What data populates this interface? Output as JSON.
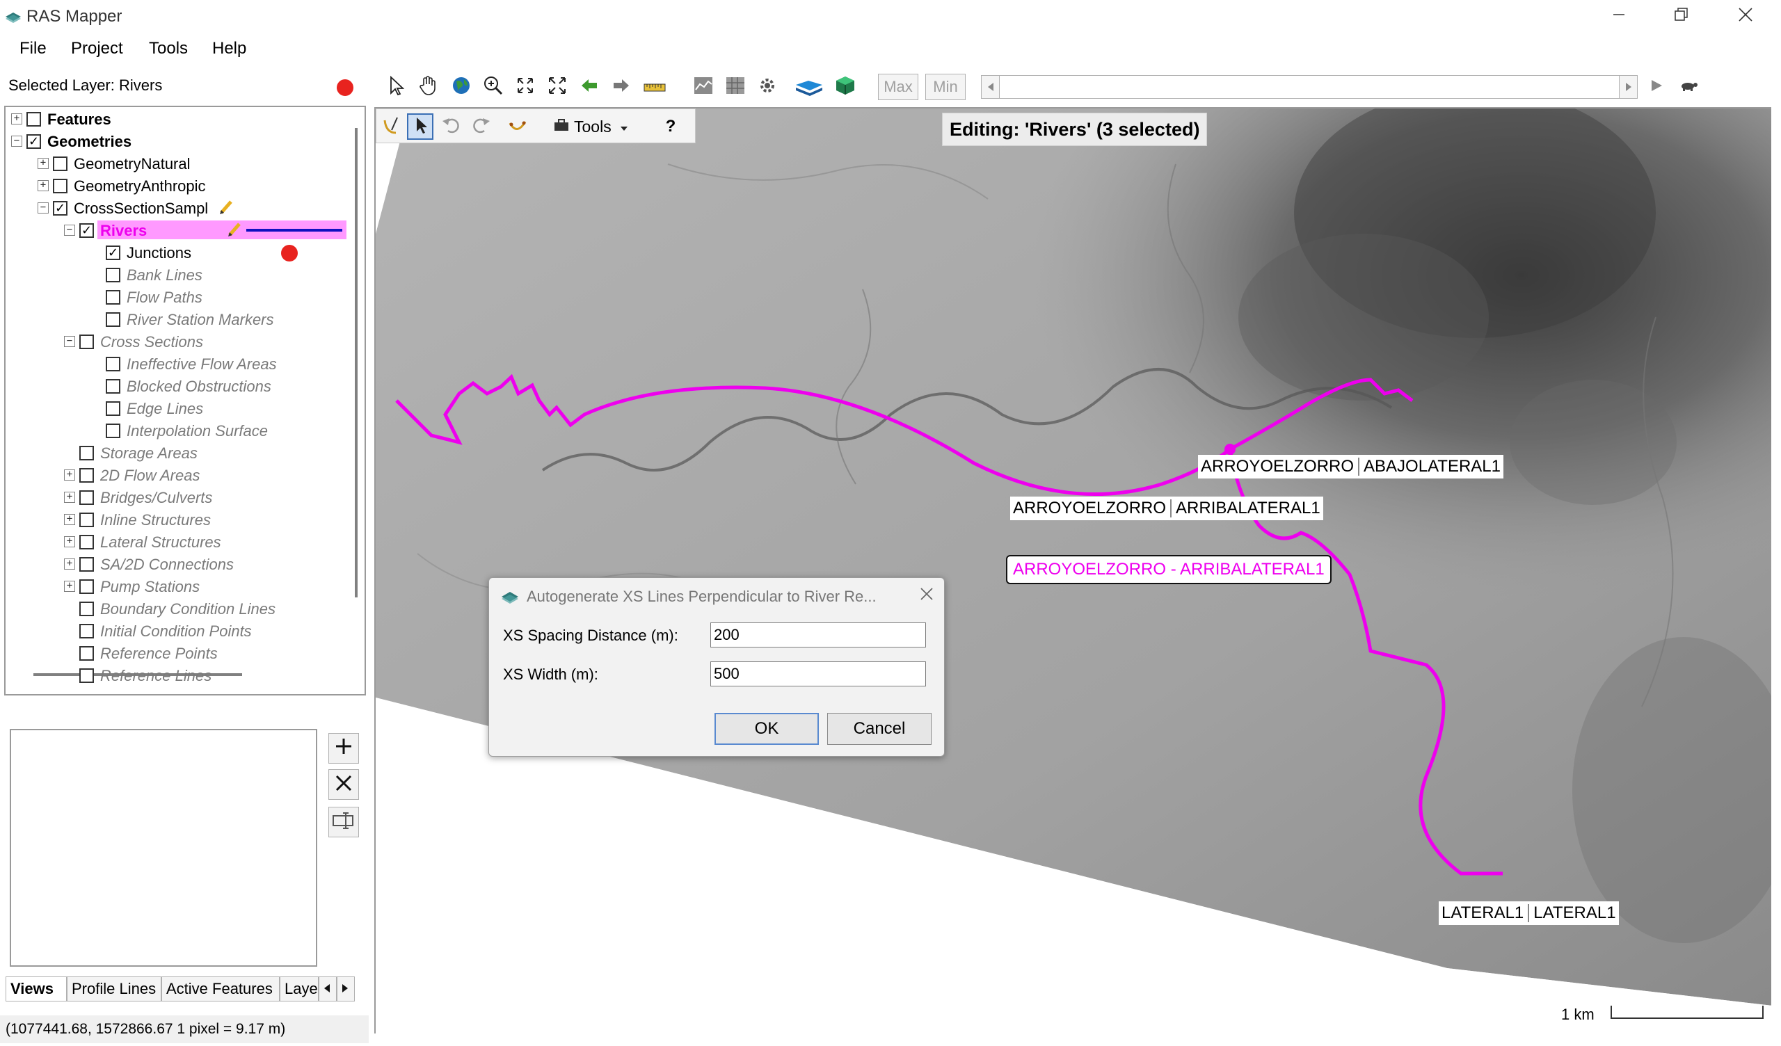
{
  "window": {
    "title": "RAS Mapper",
    "minimize_icon": "minimize-icon",
    "restore_icon": "restore-icon",
    "close_icon": "close-icon"
  },
  "menu": [
    "File",
    "Project",
    "Tools",
    "Help"
  ],
  "selected_layer": "Selected Layer: Rivers",
  "tree": [
    {
      "id": "features",
      "label": "Features",
      "checked": false,
      "expander": "+",
      "style": "bold"
    },
    {
      "id": "geometries",
      "label": "Geometries",
      "checked": true,
      "expander": "-",
      "style": "bold"
    },
    {
      "id": "geometry-natural",
      "label": "GeometryNatural",
      "checked": false,
      "expander": "+",
      "style": "normal"
    },
    {
      "id": "geometry-anthropic",
      "label": "GeometryAnthropic",
      "checked": false,
      "expander": "+",
      "style": "normal"
    },
    {
      "id": "cross-section-sample",
      "label": "CrossSectionSampl",
      "checked": true,
      "expander": "-",
      "style": "normal"
    },
    {
      "id": "rivers",
      "label": "Rivers",
      "checked": true,
      "expander": "-",
      "style": "selected"
    },
    {
      "id": "junctions",
      "label": "Junctions",
      "checked": true,
      "expander": "",
      "style": "normal"
    },
    {
      "id": "bank-lines",
      "label": "Bank Lines",
      "checked": false,
      "expander": "",
      "style": "gray"
    },
    {
      "id": "flow-paths",
      "label": "Flow Paths",
      "checked": false,
      "expander": "",
      "style": "gray"
    },
    {
      "id": "river-station-markers",
      "label": "River Station Markers",
      "checked": false,
      "expander": "",
      "style": "gray"
    },
    {
      "id": "cross-sections",
      "label": "Cross Sections",
      "checked": false,
      "expander": "-",
      "style": "gray"
    },
    {
      "id": "ineffective-flow-areas",
      "label": "Ineffective Flow Areas",
      "checked": false,
      "expander": "",
      "style": "gray"
    },
    {
      "id": "blocked-obstructions",
      "label": "Blocked Obstructions",
      "checked": false,
      "expander": "",
      "style": "gray"
    },
    {
      "id": "edge-lines",
      "label": "Edge Lines",
      "checked": false,
      "expander": "",
      "style": "gray"
    },
    {
      "id": "interpolation-surface",
      "label": "Interpolation Surface",
      "checked": false,
      "expander": "",
      "style": "gray"
    },
    {
      "id": "storage-areas",
      "label": "Storage Areas",
      "checked": false,
      "expander": "",
      "style": "gray"
    },
    {
      "id": "2d-flow-areas",
      "label": "2D Flow Areas",
      "checked": false,
      "expander": "+",
      "style": "gray"
    },
    {
      "id": "bridges-culverts",
      "label": "Bridges/Culverts",
      "checked": false,
      "expander": "+",
      "style": "gray"
    },
    {
      "id": "inline-structures",
      "label": "Inline Structures",
      "checked": false,
      "expander": "+",
      "style": "gray"
    },
    {
      "id": "lateral-structures",
      "label": "Lateral Structures",
      "checked": false,
      "expander": "+",
      "style": "gray"
    },
    {
      "id": "sa-2d-connections",
      "label": "SA/2D Connections",
      "checked": false,
      "expander": "+",
      "style": "gray"
    },
    {
      "id": "pump-stations",
      "label": "Pump Stations",
      "checked": false,
      "expander": "+",
      "style": "gray"
    },
    {
      "id": "boundary-condition-lines",
      "label": "Boundary Condition Lines",
      "checked": false,
      "expander": "",
      "style": "gray"
    },
    {
      "id": "initial-condition-points",
      "label": "Initial Condition Points",
      "checked": false,
      "expander": "",
      "style": "gray"
    },
    {
      "id": "reference-points",
      "label": "Reference Points",
      "checked": false,
      "expander": "",
      "style": "gray"
    },
    {
      "id": "reference-lines",
      "label": "Reference Lines",
      "checked": false,
      "expander": "",
      "style": "gray"
    }
  ],
  "tabs": [
    "Views",
    "Profile Lines",
    "Active Features",
    "Laye"
  ],
  "status": "(1077441.68, 1572866.67  1 pixel = 9.17 m)",
  "toolbar": {
    "max_label": "Max",
    "min_label": "Min"
  },
  "edit_toolbar": {
    "tools_label": "Tools",
    "help_label": "?"
  },
  "editing_label": "Editing: 'Rivers' (3 selected)",
  "map_labels": {
    "abajo_left": "ARROYOELZORRO",
    "abajo_right": "ABAJOLATERAL1",
    "arriba_left": "ARROYOELZORRO",
    "arriba_right": "ARRIBALATERAL1",
    "highlight": "ARROYOELZORRO - ARRIBALATERAL1",
    "lateral_left": "LATERAL1",
    "lateral_right": "LATERAL1"
  },
  "scale_label": "1 km",
  "dialog": {
    "title": "Autogenerate XS Lines Perpendicular to River Re...",
    "spacing_label": "XS Spacing Distance (m):",
    "spacing_value": "200",
    "width_label": "XS Width (m):",
    "width_value": "500",
    "ok_label": "OK",
    "cancel_label": "Cancel"
  },
  "colors": {
    "river": "#ee00ee",
    "selected_highlight": "#ff99ff",
    "legend_line": "#1010c0",
    "junction_dot": "#e8231f"
  }
}
